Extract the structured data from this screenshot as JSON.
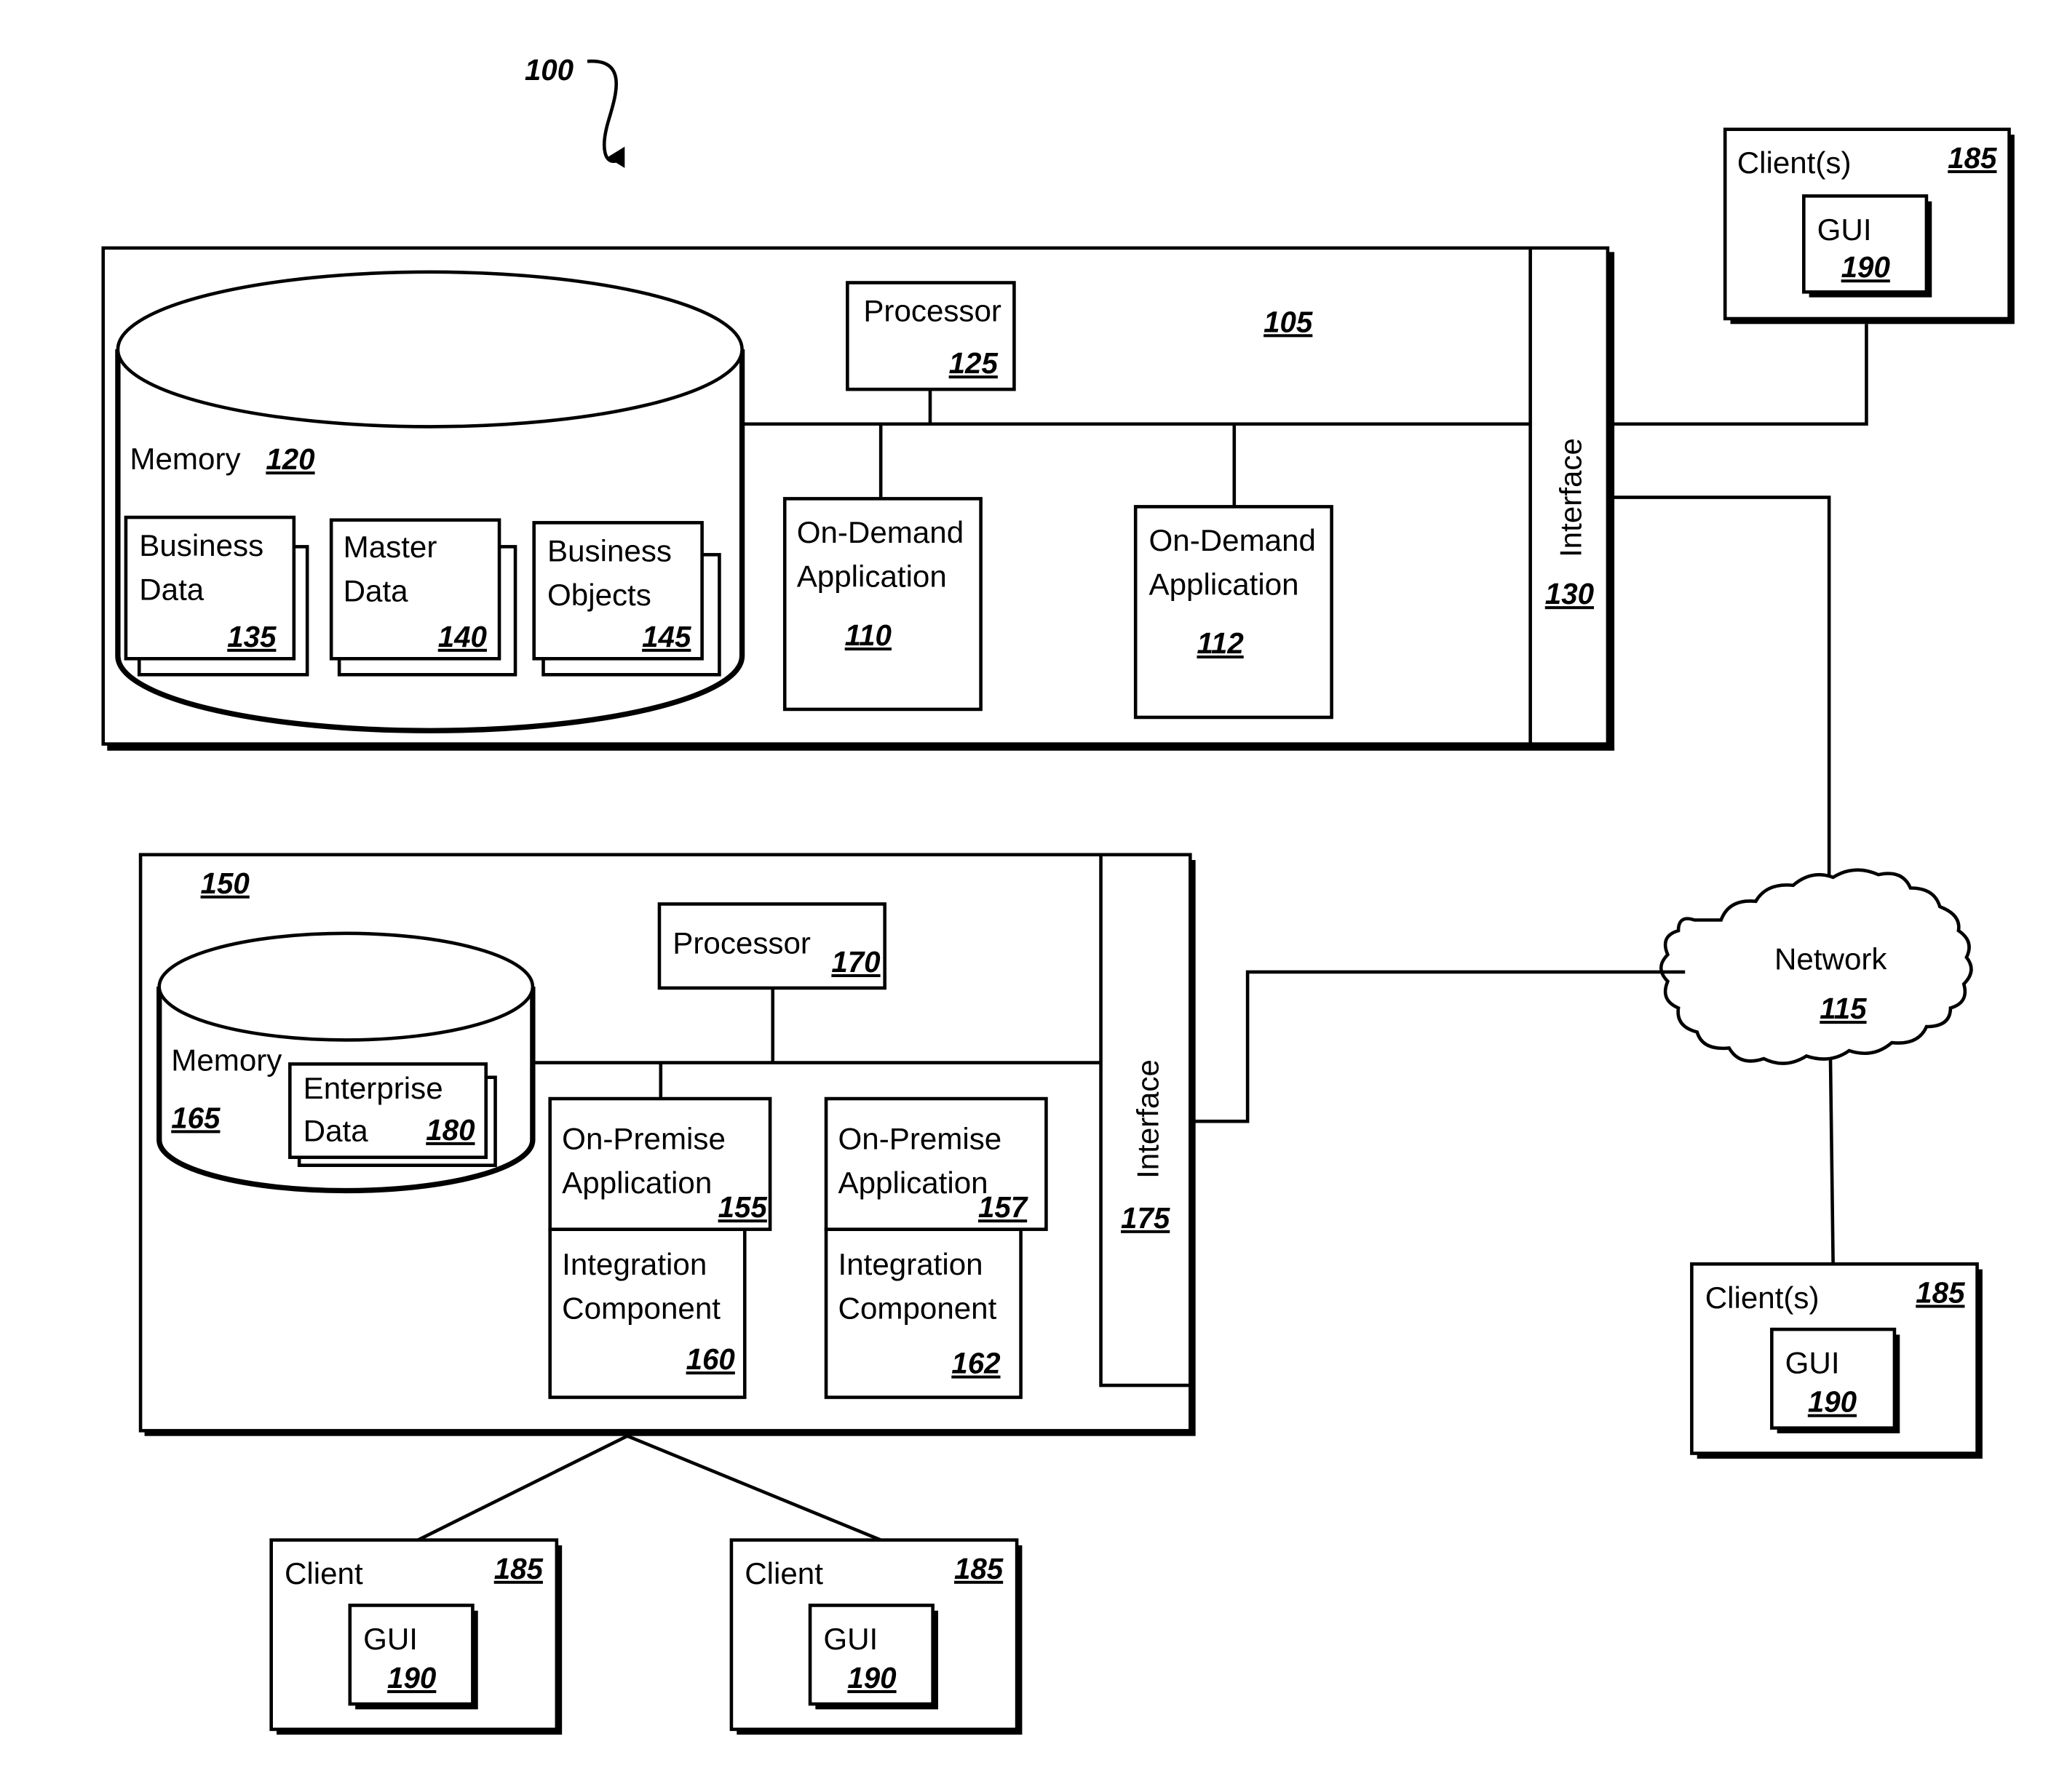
{
  "figure": {
    "reference": "100"
  },
  "on_demand_system": {
    "ref": "105",
    "memory": {
      "label": "Memory",
      "ref": "120"
    },
    "business_data": {
      "line1": "Business",
      "line2": "Data",
      "ref": "135"
    },
    "master_data": {
      "line1": "Master",
      "line2": "Data",
      "ref": "140"
    },
    "business_objects": {
      "line1": "Business",
      "line2": "Objects",
      "ref": "145"
    },
    "processor": {
      "label": "Processor",
      "ref": "125"
    },
    "app_110": {
      "line1": "On-Demand",
      "line2": "Application",
      "ref": "110"
    },
    "app_112": {
      "line1": "On-Demand",
      "line2": "Application",
      "ref": "112"
    },
    "interface": {
      "label": "Interface",
      "ref": "130"
    }
  },
  "on_premise_system": {
    "ref": "150",
    "memory": {
      "label": "Memory",
      "ref": "165"
    },
    "enterprise_data": {
      "line1": "Enterprise",
      "line2": "Data",
      "ref": "180"
    },
    "processor": {
      "label": "Processor",
      "ref": "170"
    },
    "app_155": {
      "line1": "On-Premise",
      "line2": "Application",
      "ref": "155"
    },
    "app_157": {
      "line1": "On-Premise",
      "line2": "Application",
      "ref": "157"
    },
    "integration_160": {
      "line1": "Integration",
      "line2": "Component",
      "ref": "160"
    },
    "integration_162": {
      "line1": "Integration",
      "line2": "Component",
      "ref": "162"
    },
    "interface": {
      "label": "Interface",
      "ref": "175"
    }
  },
  "network": {
    "label": "Network",
    "ref": "115"
  },
  "clients": [
    {
      "label": "Client(s)",
      "ref": "185",
      "gui_label": "GUI",
      "gui_ref": "190"
    },
    {
      "label": "Client(s)",
      "ref": "185",
      "gui_label": "GUI",
      "gui_ref": "190"
    },
    {
      "label": "Client",
      "ref": "185",
      "gui_label": "GUI",
      "gui_ref": "190"
    },
    {
      "label": "Client",
      "ref": "185",
      "gui_label": "GUI",
      "gui_ref": "190"
    }
  ]
}
